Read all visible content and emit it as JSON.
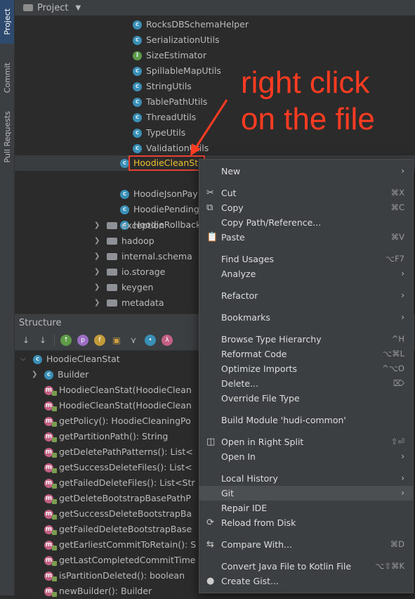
{
  "side_tabs": {
    "project": "Project",
    "commit": "Commit",
    "pull_requests": "Pull Requests"
  },
  "project_pane": {
    "title": "Project"
  },
  "files": [
    {
      "name": "RocksDBSchemaHelper",
      "icon": "c"
    },
    {
      "name": "SerializationUtils",
      "icon": "c"
    },
    {
      "name": "SizeEstimator",
      "icon": "i"
    },
    {
      "name": "SpillableMapUtils",
      "icon": "c"
    },
    {
      "name": "StringUtils",
      "icon": "c"
    },
    {
      "name": "TablePathUtils",
      "icon": "c"
    },
    {
      "name": "ThreadUtils",
      "icon": "c"
    },
    {
      "name": "TypeUtils",
      "icon": "c"
    },
    {
      "name": "ValidationUtils",
      "icon": "c"
    }
  ],
  "files2": [
    {
      "name": "HoodieCleanStat"
    },
    {
      "name": "HoodieJsonPay"
    },
    {
      "name": "HoodiePending"
    },
    {
      "name": "HoodieRollback"
    }
  ],
  "folders": [
    "exception",
    "hadoop",
    "internal.schema",
    "io.storage",
    "keygen",
    "metadata"
  ],
  "structure": {
    "title": "Structure",
    "root": "HoodieCleanStat",
    "builder": "Builder",
    "members": [
      "HoodieCleanStat(HoodieClean",
      "HoodieCleanStat(HoodieClean",
      "getPolicy(): HoodieCleaningPo",
      "getPartitionPath(): String",
      "getDeletePathPatterns(): List<",
      "getSuccessDeleteFiles(): List<",
      "getFailedDeleteFiles(): List<Str",
      "getDeleteBootstrapBasePathP",
      "getSuccessDeleteBootstrapBa",
      "getFailedDeleteBootstrapBase",
      "getEarliestCommitToRetain(): S",
      "getLastCompletedCommitTime",
      "isPartitionDeleted(): boolean",
      "newBuilder(): Builder"
    ]
  },
  "context_menu": [
    {
      "label": "New",
      "submenu": true,
      "gap_before": false
    },
    {
      "label": "Cut",
      "shortcut": "⌘X",
      "icon": "✂",
      "gap_before": true
    },
    {
      "label": "Copy",
      "shortcut": "⌘C",
      "icon": "⧉"
    },
    {
      "label": "Copy Path/Reference..."
    },
    {
      "label": "Paste",
      "shortcut": "⌘V",
      "icon": "📋"
    },
    {
      "label": "Find Usages",
      "shortcut": "⌥F7",
      "gap_before": true
    },
    {
      "label": "Analyze",
      "submenu": true
    },
    {
      "label": "Refactor",
      "submenu": true,
      "gap_before": true
    },
    {
      "label": "Bookmarks",
      "submenu": true,
      "gap_before": true
    },
    {
      "label": "Browse Type Hierarchy",
      "shortcut": "^H",
      "gap_before": true
    },
    {
      "label": "Reformat Code",
      "shortcut": "⌥⌘L"
    },
    {
      "label": "Optimize Imports",
      "shortcut": "^⌥O"
    },
    {
      "label": "Delete...",
      "shortcut": "⌦"
    },
    {
      "label": "Override File Type"
    },
    {
      "label": "Build Module 'hudi-common'",
      "gap_before": true
    },
    {
      "label": "Open in Right Split",
      "shortcut": "⇧⏎",
      "icon": "◫",
      "gap_before": true
    },
    {
      "label": "Open In",
      "submenu": true
    },
    {
      "label": "Local History",
      "submenu": true,
      "gap_before": true
    },
    {
      "label": "Git",
      "submenu": true,
      "highlighted": true
    },
    {
      "label": "Repair IDE"
    },
    {
      "label": "Reload from Disk",
      "icon": "⟳"
    },
    {
      "label": "Compare With...",
      "shortcut": "⌘D",
      "icon": "⇆",
      "gap_before": true
    },
    {
      "label": "Convert Java File to Kotlin File",
      "shortcut": "⌥⇧⌘K",
      "gap_before": true
    },
    {
      "label": "Create Gist...",
      "icon": "●"
    }
  ],
  "annotation": {
    "line1": "right click",
    "line2": "on the file",
    "color": "#ff3b22"
  }
}
